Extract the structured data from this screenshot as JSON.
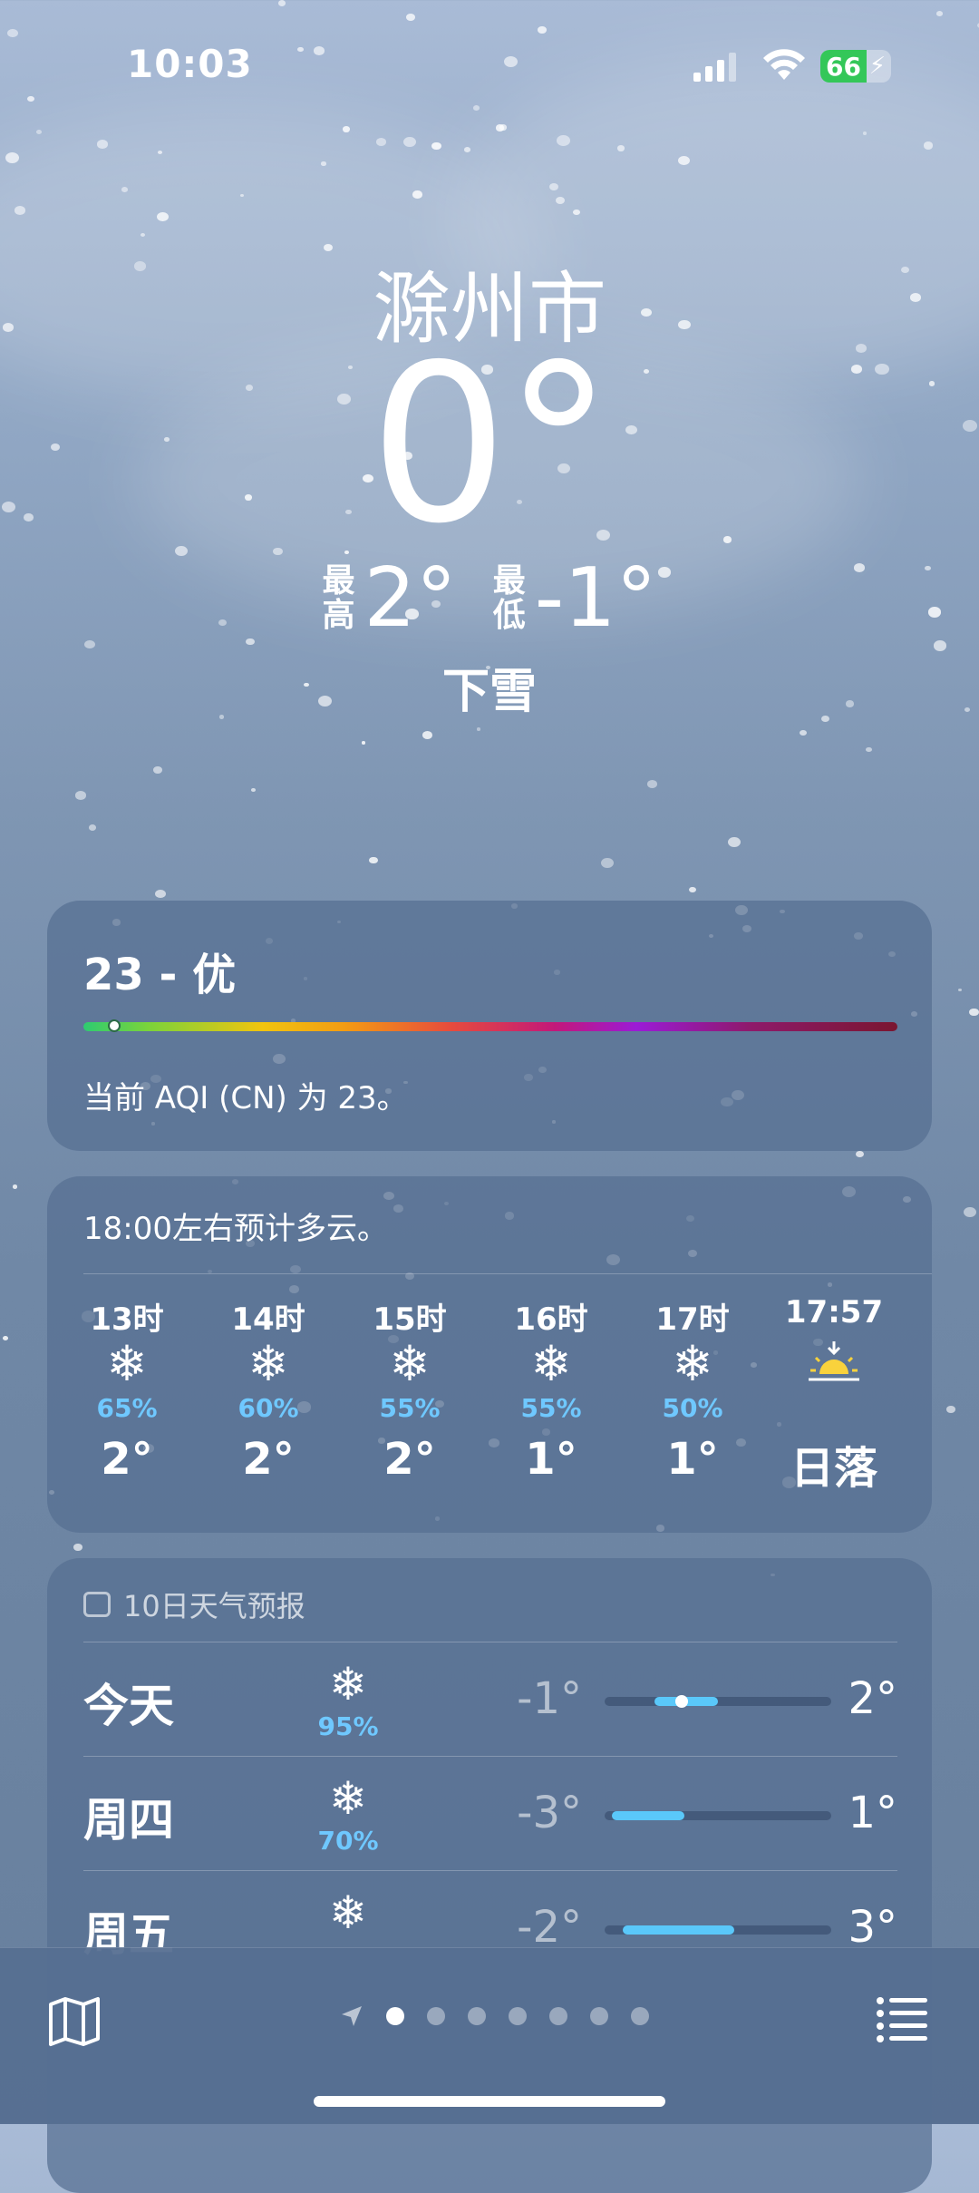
{
  "status_bar": {
    "time": "10:03",
    "battery": "66"
  },
  "header": {
    "city": "滁州市",
    "temperature": "0°",
    "high_label_1": "最",
    "high_label_2": "高",
    "high": "2°",
    "low_label_1": "最",
    "low_label_2": "低",
    "low": "-1°",
    "condition": "下雪"
  },
  "aqi": {
    "title": "23 - 优",
    "value_fraction": 0.03,
    "description": "当前 AQI (CN) 为 23。"
  },
  "hourly": {
    "note": "18:00左右预计多云。",
    "items": [
      {
        "time": "13时",
        "icon": "snowflake-icon",
        "pct": "65%",
        "temp": "2°"
      },
      {
        "time": "14时",
        "icon": "snowflake-icon",
        "pct": "60%",
        "temp": "2°"
      },
      {
        "time": "15时",
        "icon": "snowflake-icon",
        "pct": "55%",
        "temp": "2°"
      },
      {
        "time": "16时",
        "icon": "snowflake-icon",
        "pct": "55%",
        "temp": "1°"
      },
      {
        "time": "17时",
        "icon": "snowflake-icon",
        "pct": "50%",
        "temp": "1°"
      },
      {
        "time": "17:57",
        "icon": "sunset-icon",
        "pct": "",
        "temp": "日落"
      }
    ]
  },
  "daily": {
    "header": "10日天气预报",
    "rows": [
      {
        "day": "今天",
        "icon": "snowflake-icon",
        "pct": "95%",
        "low": "-1°",
        "high": "2°"
      },
      {
        "day": "周四",
        "icon": "snowflake-icon",
        "pct": "70%",
        "low": "-3°",
        "high": "1°"
      },
      {
        "day": "周五",
        "icon": "snowflake-icon",
        "pct": "",
        "low": "-2°",
        "high": "3°"
      }
    ]
  },
  "colors": {
    "accent_blue": "#5ac8fa",
    "battery_green": "#34c759"
  }
}
